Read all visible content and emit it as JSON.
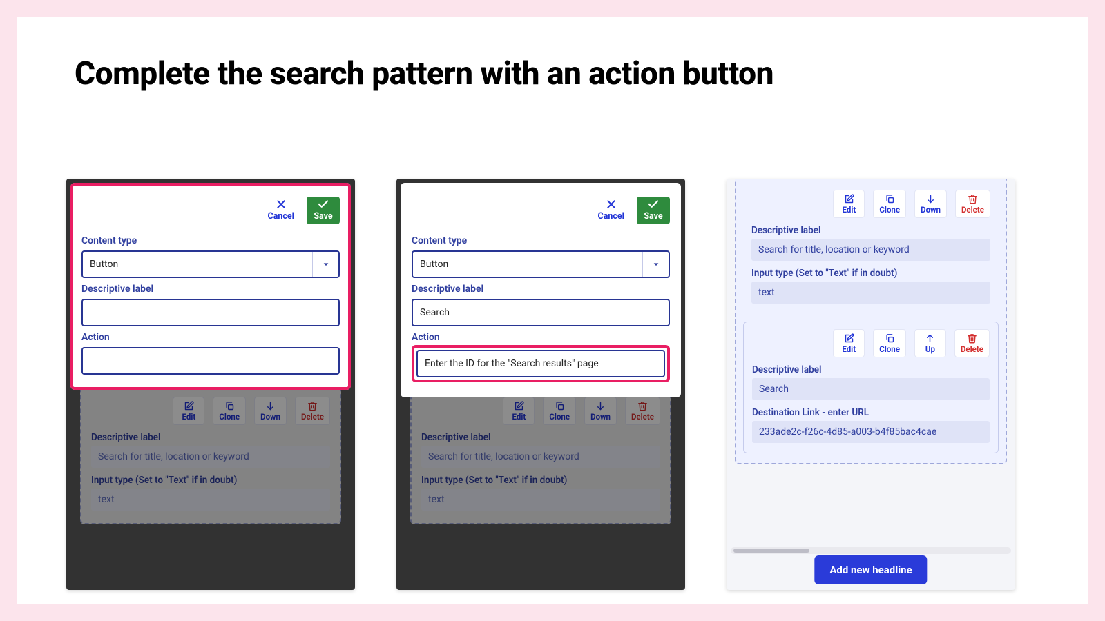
{
  "title": "Complete the search pattern with an action button",
  "dialog": {
    "cancel": "Cancel",
    "save": "Save",
    "content_type_label": "Content type",
    "content_type_value": "Button",
    "descriptive_label": "Descriptive label",
    "action_label": "Action"
  },
  "panel2": {
    "descriptive_value": "Search",
    "action_value": "Enter the ID for the \"Search results\" page"
  },
  "dash": {
    "edit": "Edit",
    "clone": "Clone",
    "down": "Down",
    "up": "Up",
    "delete": "Delete",
    "descriptive_label": "Descriptive label",
    "descriptive_value": "Search for title, location or keyword",
    "input_type_label": "Input type (Set to \"Text\" if in doubt)",
    "input_type_value": "text"
  },
  "p3": {
    "card2_descriptive_value": "Search",
    "dest_link_label": "Destination Link - enter URL",
    "dest_link_value": "233ade2c-f26c-4d85-a003-b4f85bac4cae",
    "add_headline": "Add new headline"
  }
}
